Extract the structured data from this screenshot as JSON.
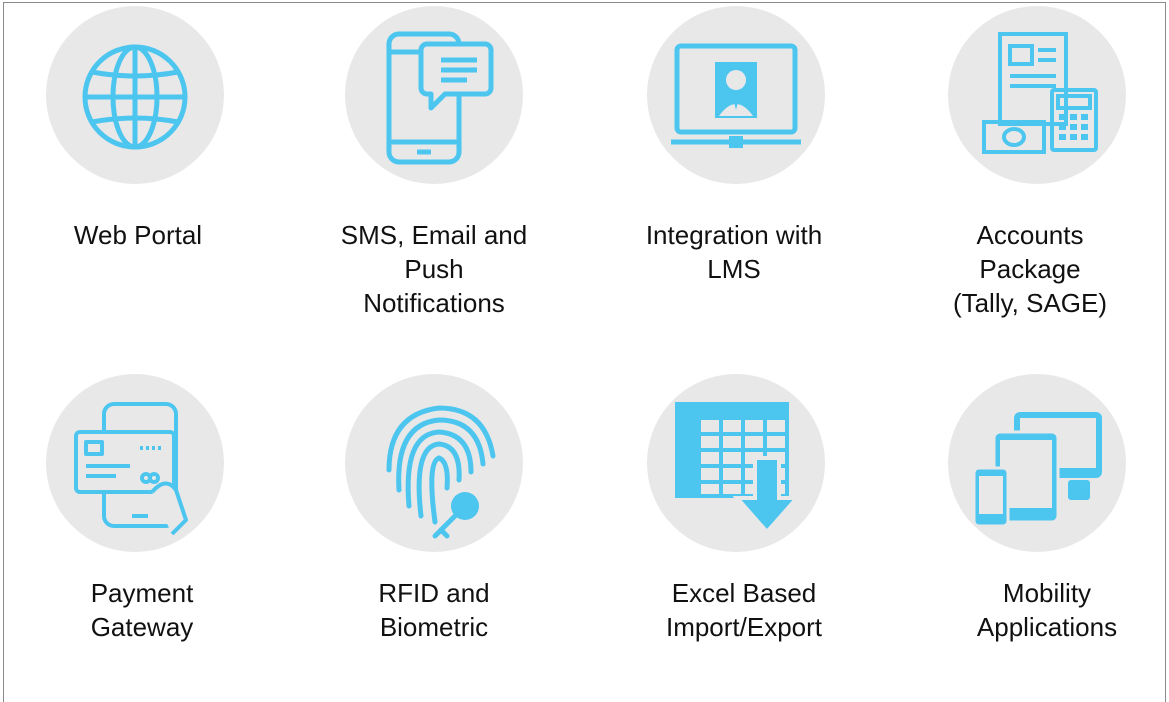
{
  "accent_color": "#4dc6ef",
  "circle_color": "#e8e8e8",
  "features": [
    {
      "icon": "globe-icon",
      "lines": [
        "Web Portal"
      ]
    },
    {
      "icon": "phone-chat-icon",
      "lines": [
        "SMS, Email and",
        "Push",
        "Notifications"
      ]
    },
    {
      "icon": "monitor-person-icon",
      "lines": [
        "Integration with",
        "LMS"
      ]
    },
    {
      "icon": "accounts-calculator-icon",
      "lines": [
        "Accounts",
        "Package",
        "(Tally, SAGE)"
      ]
    },
    {
      "icon": "credit-card-phone-icon",
      "lines": [
        "Payment",
        "Gateway"
      ]
    },
    {
      "icon": "fingerprint-icon",
      "lines": [
        "RFID and",
        "Biometric"
      ]
    },
    {
      "icon": "spreadsheet-download-icon",
      "lines": [
        "Excel Based",
        "Import/Export"
      ]
    },
    {
      "icon": "devices-icon",
      "lines": [
        "Mobility",
        "Applications"
      ]
    }
  ]
}
